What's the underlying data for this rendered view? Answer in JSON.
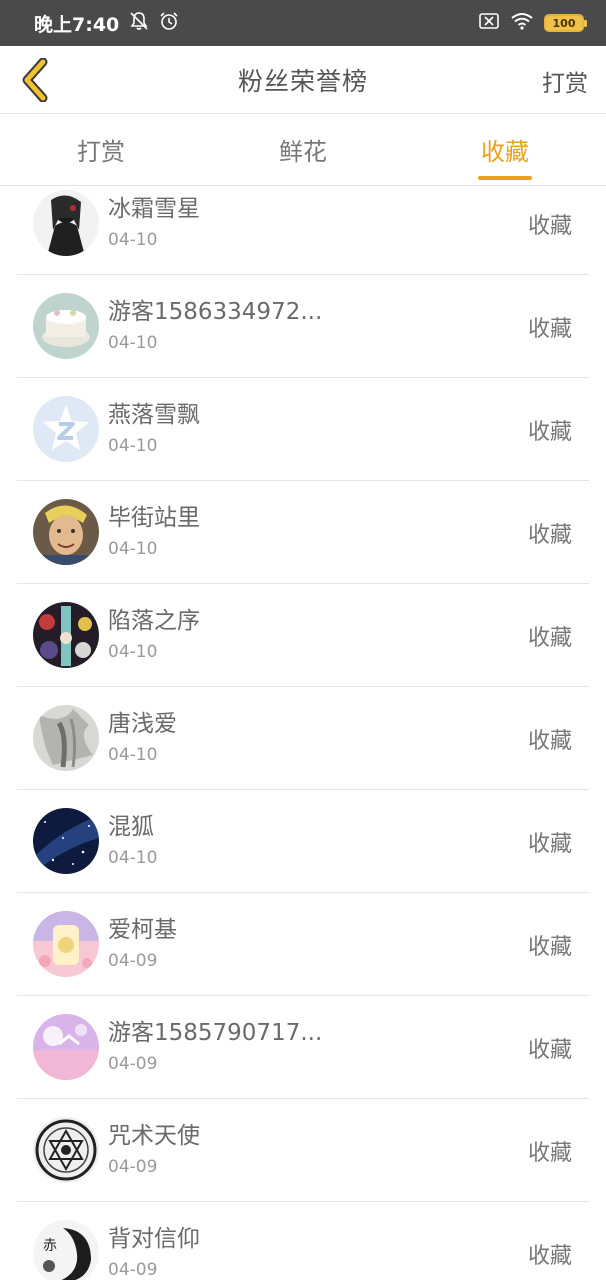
{
  "status_bar": {
    "time": "晚上7:40",
    "battery": "100"
  },
  "header": {
    "title": "粉丝荣誉榜",
    "action": "打赏"
  },
  "tabs": [
    {
      "label": "打赏",
      "active": false
    },
    {
      "label": "鲜花",
      "active": false
    },
    {
      "label": "收藏",
      "active": true
    }
  ],
  "colors": {
    "accent": "#e8a21c",
    "status_bar": "#4a4a4a",
    "divider": "#e6e6e6"
  },
  "fans": [
    {
      "name": "冰霜雪星",
      "date": "04-10",
      "type": "收藏"
    },
    {
      "name": "游客1586334972...",
      "date": "04-10",
      "type": "收藏"
    },
    {
      "name": "燕落雪飘",
      "date": "04-10",
      "type": "收藏"
    },
    {
      "name": "毕街站里",
      "date": "04-10",
      "type": "收藏"
    },
    {
      "name": "陷落之序",
      "date": "04-10",
      "type": "收藏"
    },
    {
      "name": "唐浅爱",
      "date": "04-10",
      "type": "收藏"
    },
    {
      "name": "混狐",
      "date": "04-10",
      "type": "收藏"
    },
    {
      "name": "爱柯基",
      "date": "04-09",
      "type": "收藏"
    },
    {
      "name": "游客1585790717...",
      "date": "04-09",
      "type": "收藏"
    },
    {
      "name": "咒术天使",
      "date": "04-09",
      "type": "收藏"
    },
    {
      "name": "背对信仰",
      "date": "04-09",
      "type": "收藏"
    }
  ]
}
